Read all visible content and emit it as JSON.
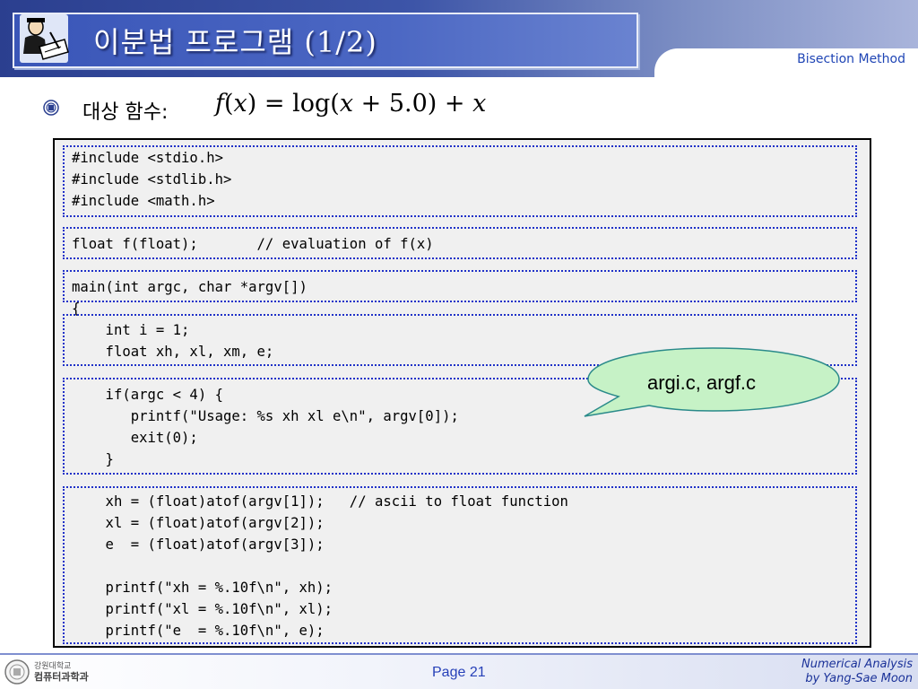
{
  "header": {
    "title": "이분법 프로그램 (1/2)",
    "topic": "Bisection Method"
  },
  "bullet": {
    "label": "대상 함수:",
    "formula": {
      "f": "f",
      "x1": "x",
      "eq": " = log(",
      "x2": "x",
      "rest": " + 5.0) + ",
      "x3": "x"
    }
  },
  "code": {
    "includes": "#include <stdio.h>\n#include <stdlib.h>\n#include <math.h>",
    "prototype": "float f(float);       // evaluation of f(x)",
    "main_sig": "main(int argc, char *argv[])",
    "brace_open": "{",
    "decls": "    int i = 1;\n    float xh, xl, xm, e;",
    "argcheck": "    if(argc < 4) {\n       printf(\"Usage: %s xh xl e\\n\", argv[0]);\n       exit(0);\n    }",
    "parse_print": "    xh = (float)atof(argv[1]);   // ascii to float function\n    xl = (float)atof(argv[2]);\n    e  = (float)atof(argv[3]);\n\n    printf(\"xh = %.10f\\n\", xh);\n    printf(\"xl = %.10f\\n\", xl);\n    printf(\"e  = %.10f\\n\", e);"
  },
  "callout": {
    "text": "argi.c, argf.c"
  },
  "footer": {
    "univ_line1": "강원대학교",
    "univ_line2": "컴퓨터과학과",
    "page": "Page 21",
    "course_line1": "Numerical Analysis",
    "course_line2": "by Yang-Sae Moon"
  },
  "colors": {
    "accent": "#2b3f8f",
    "code_border": "#1f31c8",
    "callout_fill": "#c6f2c6",
    "topic_text": "#1f45b5"
  },
  "icons": [
    "professor-at-desk-icon",
    "university-seal-icon",
    "bullet-seal-icon"
  ]
}
